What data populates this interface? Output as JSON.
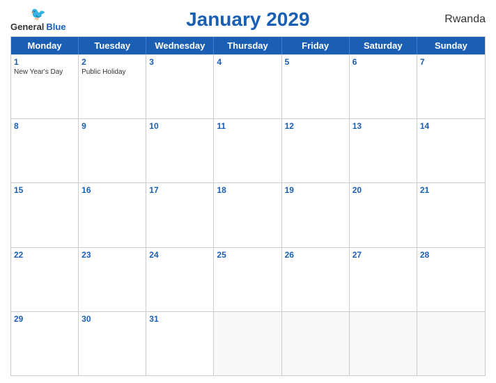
{
  "logo": {
    "general": "General",
    "blue": "Blue"
  },
  "title": "January 2029",
  "country": "Rwanda",
  "days_of_week": [
    "Monday",
    "Tuesday",
    "Wednesday",
    "Thursday",
    "Friday",
    "Saturday",
    "Sunday"
  ],
  "weeks": [
    [
      {
        "num": "1",
        "event": "New Year's Day"
      },
      {
        "num": "2",
        "event": "Public Holiday"
      },
      {
        "num": "3",
        "event": ""
      },
      {
        "num": "4",
        "event": ""
      },
      {
        "num": "5",
        "event": ""
      },
      {
        "num": "6",
        "event": ""
      },
      {
        "num": "7",
        "event": ""
      }
    ],
    [
      {
        "num": "8",
        "event": ""
      },
      {
        "num": "9",
        "event": ""
      },
      {
        "num": "10",
        "event": ""
      },
      {
        "num": "11",
        "event": ""
      },
      {
        "num": "12",
        "event": ""
      },
      {
        "num": "13",
        "event": ""
      },
      {
        "num": "14",
        "event": ""
      }
    ],
    [
      {
        "num": "15",
        "event": ""
      },
      {
        "num": "16",
        "event": ""
      },
      {
        "num": "17",
        "event": ""
      },
      {
        "num": "18",
        "event": ""
      },
      {
        "num": "19",
        "event": ""
      },
      {
        "num": "20",
        "event": ""
      },
      {
        "num": "21",
        "event": ""
      }
    ],
    [
      {
        "num": "22",
        "event": ""
      },
      {
        "num": "23",
        "event": ""
      },
      {
        "num": "24",
        "event": ""
      },
      {
        "num": "25",
        "event": ""
      },
      {
        "num": "26",
        "event": ""
      },
      {
        "num": "27",
        "event": ""
      },
      {
        "num": "28",
        "event": ""
      }
    ],
    [
      {
        "num": "29",
        "event": ""
      },
      {
        "num": "30",
        "event": ""
      },
      {
        "num": "31",
        "event": ""
      },
      {
        "num": "",
        "event": ""
      },
      {
        "num": "",
        "event": ""
      },
      {
        "num": "",
        "event": ""
      },
      {
        "num": "",
        "event": ""
      }
    ]
  ]
}
